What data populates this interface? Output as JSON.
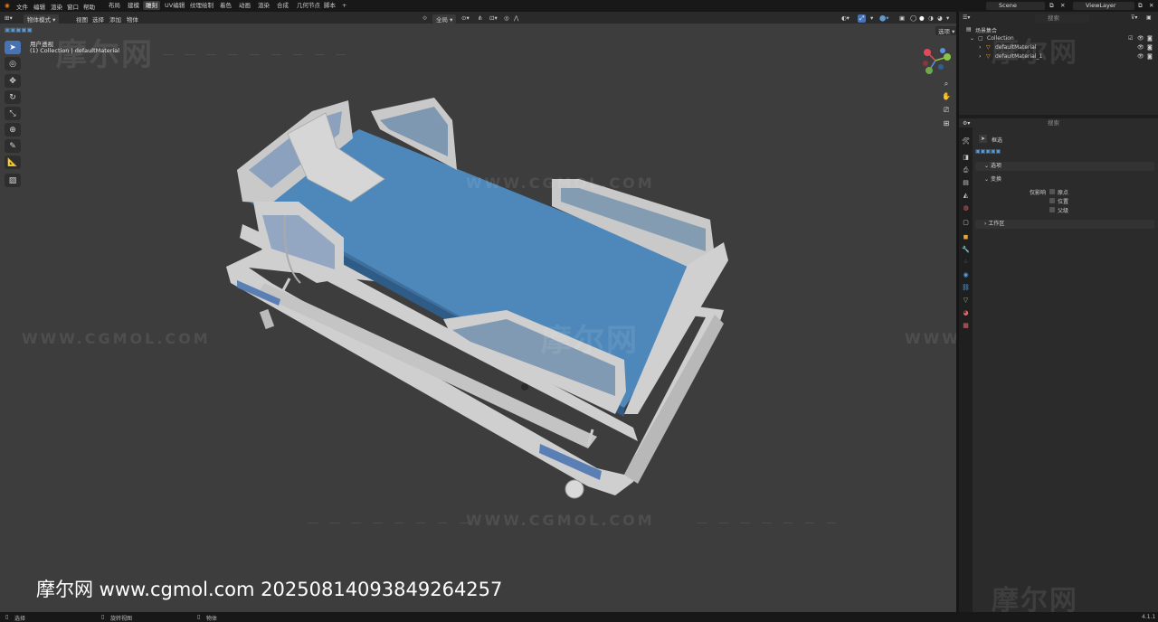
{
  "menu": [
    "文件",
    "编辑",
    "渲染",
    "窗口",
    "帮助"
  ],
  "workspaces": [
    {
      "label": "布局",
      "active": false
    },
    {
      "label": "建模",
      "active": false
    },
    {
      "label": "雕刻",
      "active": true
    },
    {
      "label": "UV编辑",
      "active": false
    },
    {
      "label": "纹理绘制",
      "active": false
    },
    {
      "label": "着色",
      "active": false
    },
    {
      "label": "动画",
      "active": false
    },
    {
      "label": "渲染",
      "active": false
    },
    {
      "label": "合成",
      "active": false
    },
    {
      "label": "几何节点",
      "active": false
    },
    {
      "label": "脚本",
      "active": false
    }
  ],
  "add_workspace": "+",
  "scene_field": "Scene",
  "view_layer_field": "ViewLayer",
  "viewport": {
    "mode": "物体模式",
    "menus": [
      "视图",
      "选择",
      "添加",
      "物体"
    ],
    "transform_orientation": "全局",
    "view_name": "用户透视",
    "collection_info": "(1) Collection | defaultMaterial",
    "options_label": "选项"
  },
  "watermarks": {
    "logo": "摩尔网",
    "url": "WWW.CGMOL.COM",
    "credit": "摩尔网 www.cgmol.com 20250814093849264257"
  },
  "outliner": {
    "search_placeholder": "搜索",
    "root": "场景集合",
    "collection": "Collection",
    "items": [
      "defaultMaterial",
      "defaultMaterial_1"
    ]
  },
  "properties": {
    "search_placeholder": "搜索",
    "tool_title": "框选",
    "panel_options": "选项",
    "sub_transform": "变换",
    "affect_only": "仅影响",
    "affect_items": [
      "原点",
      "位置",
      "父级"
    ],
    "panel_workspace": "工作区"
  },
  "status": {
    "left": "选择",
    "mid": "旋转视图",
    "right": "物体",
    "version": "4.1.1"
  },
  "colors": {
    "accent": "#4772b3",
    "mattress": "#4e88ba",
    "frame": "#c9c9c9",
    "viewport_bg": "#3d3d3d"
  }
}
